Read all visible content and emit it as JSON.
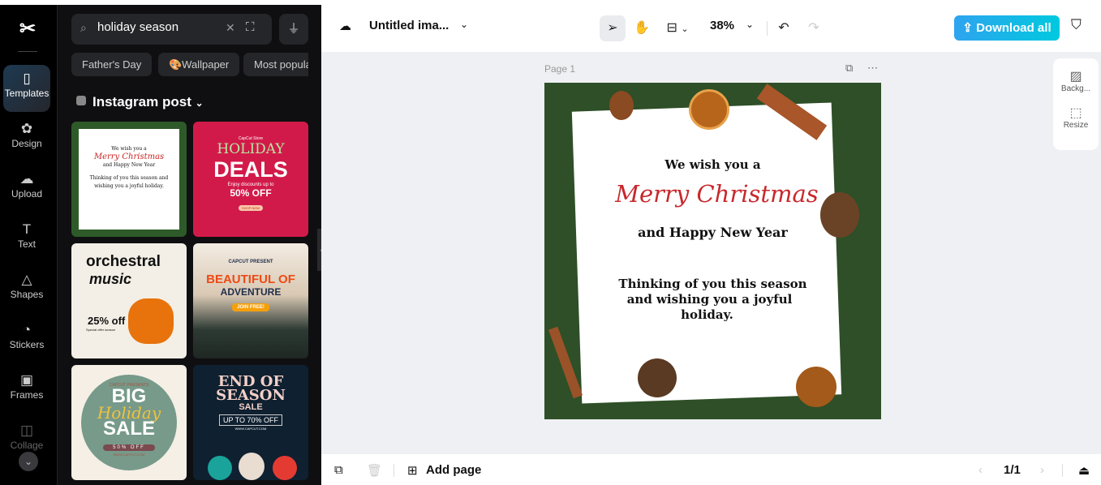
{
  "rail": {
    "logo": "CapCut",
    "items": [
      {
        "label": "Templates",
        "icon": "templates-icon",
        "glyph": "▯"
      },
      {
        "label": "Design",
        "icon": "design-icon",
        "glyph": "✿"
      },
      {
        "label": "Upload",
        "icon": "upload-icon",
        "glyph": "☁"
      },
      {
        "label": "Text",
        "icon": "text-icon",
        "glyph": "T"
      },
      {
        "label": "Shapes",
        "icon": "shapes-icon",
        "glyph": "△"
      },
      {
        "label": "Stickers",
        "icon": "stickers-icon",
        "glyph": "◔"
      },
      {
        "label": "Frames",
        "icon": "frames-icon",
        "glyph": "▣"
      },
      {
        "label": "Collage",
        "icon": "collage-icon",
        "glyph": "◫"
      }
    ]
  },
  "panel": {
    "search_value": "holiday season",
    "chips": [
      "Father's Day",
      "🎨Wallpaper",
      "Most popular"
    ],
    "section_title": "Instagram post",
    "templates": [
      {
        "lines": [
          "We wish you a",
          "Merry Christmas",
          "and Happy New Year",
          "Thinking of you this season and wishing you a joyful holiday."
        ]
      },
      {
        "lines": [
          "CapCut Store",
          "HOLIDAY",
          "DEALS",
          "Enjoy discounts up to",
          "50% OFF",
          "SHOP NOW"
        ]
      },
      {
        "lines": [
          "orchestral",
          "music",
          "25% off",
          "Special offer season"
        ]
      },
      {
        "lines": [
          "CAPCUT PRESENT",
          "BEAUTIFUL OF",
          "ADVENTURE",
          "JOIN FREE!"
        ]
      },
      {
        "lines": [
          "CAPCUT PRESENTS",
          "BIG",
          "Holiday",
          "SALE",
          "50% OFF",
          "WWW.CAPCUT.COM"
        ]
      },
      {
        "lines": [
          "END OF",
          "SEASON",
          "SALE",
          "UP TO 70% OFF",
          "WWW.CAPCUT.COM"
        ]
      }
    ]
  },
  "topbar": {
    "title": "Untitled ima...",
    "zoom": "38%",
    "download_label": "Download all"
  },
  "stage": {
    "page_label": "Page 1",
    "design": {
      "line1": "We wish you a",
      "line2": "Merry Christmas",
      "line3": "and Happy New Year",
      "line4": "Thinking of you this season",
      "line5": "and wishing you a joyful",
      "line6": "holiday."
    },
    "side_tools": [
      "Backg...",
      "Resize"
    ]
  },
  "bottom": {
    "add_page": "Add page",
    "page_count": "1/1"
  },
  "colors": {
    "accent_start": "#2ea4ef",
    "accent_end": "#00c9df",
    "christmas_red": "#c8282c"
  }
}
